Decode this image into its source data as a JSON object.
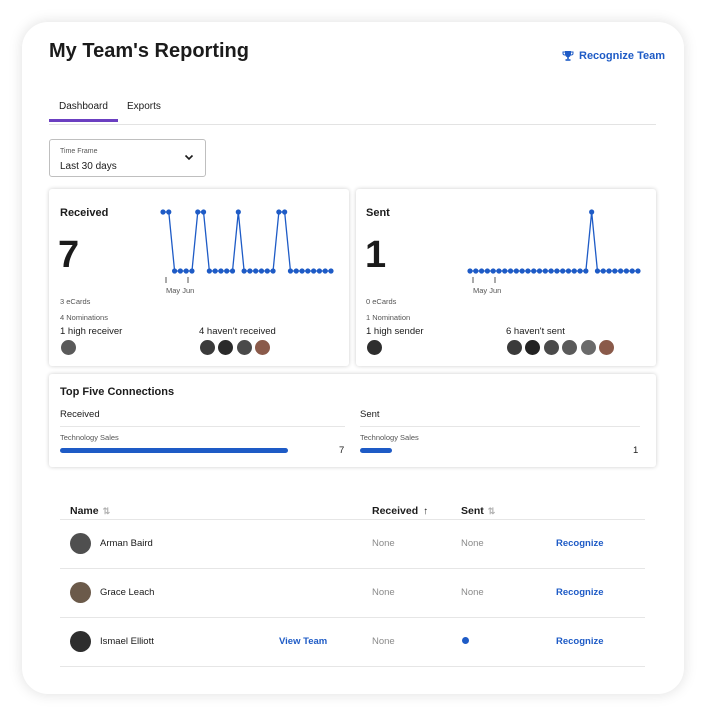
{
  "header": {
    "title": "My Team's Reporting",
    "recognize_team": "Recognize Team"
  },
  "tabs": [
    {
      "label": "Dashboard",
      "active": true
    },
    {
      "label": "Exports",
      "active": false
    }
  ],
  "time_frame": {
    "label": "Time Frame",
    "value": "Last 30 days"
  },
  "received_card": {
    "title": "Received",
    "total": "7",
    "ecards": "3 eCards",
    "nominations": "4 Nominations",
    "high_label": "1 high receiver",
    "havent_label": "4 haven't received",
    "axis_labels": [
      "May",
      "Jun"
    ],
    "high_avatar_count": 1,
    "havent_avatar_count": 4
  },
  "sent_card": {
    "title": "Sent",
    "total": "1",
    "ecards": "0 eCards",
    "nominations": "1 Nomination",
    "high_label": "1 high sender",
    "havent_label": "6 haven't sent",
    "axis_labels": [
      "May",
      "Jun"
    ],
    "high_avatar_count": 1,
    "havent_avatar_count": 6
  },
  "chart_data": [
    {
      "type": "line",
      "title": "Received",
      "x": [
        1,
        2,
        3,
        4,
        5,
        6,
        7,
        8,
        9,
        10,
        11,
        12,
        13,
        14,
        15,
        16,
        17,
        18,
        19,
        20,
        21,
        22,
        23,
        24,
        25,
        26,
        27,
        28,
        29,
        30
      ],
      "values": [
        1,
        1,
        0,
        0,
        0,
        0,
        1,
        1,
        0,
        0,
        0,
        0,
        0,
        1,
        0,
        0,
        0,
        0,
        0,
        0,
        1,
        1,
        0,
        0,
        0,
        0,
        0,
        0,
        0,
        0
      ],
      "xlabel": "",
      "ylabel": "",
      "tick_labels": [
        "May",
        "Jun"
      ],
      "color": "#1e5bc6"
    },
    {
      "type": "line",
      "title": "Sent",
      "x": [
        1,
        2,
        3,
        4,
        5,
        6,
        7,
        8,
        9,
        10,
        11,
        12,
        13,
        14,
        15,
        16,
        17,
        18,
        19,
        20,
        21,
        22,
        23,
        24,
        25,
        26,
        27,
        28,
        29,
        30
      ],
      "values": [
        0,
        0,
        0,
        0,
        0,
        0,
        0,
        0,
        0,
        0,
        0,
        0,
        0,
        0,
        0,
        0,
        0,
        0,
        0,
        0,
        0,
        1,
        0,
        0,
        0,
        0,
        0,
        0,
        0,
        0
      ],
      "xlabel": "",
      "ylabel": "",
      "tick_labels": [
        "May",
        "Jun"
      ],
      "color": "#1e5bc6"
    }
  ],
  "connections": {
    "title": "Top Five Connections",
    "received": {
      "label": "Received",
      "dept": "Technology Sales",
      "value": "7",
      "fraction": 1.0
    },
    "sent": {
      "label": "Sent",
      "dept": "Technology Sales",
      "value": "1",
      "fraction": 0.12
    }
  },
  "table": {
    "headers": {
      "name": "Name",
      "received": "Received",
      "sent": "Sent"
    },
    "rows": [
      {
        "name": "Arman Baird",
        "received": "None",
        "sent": "None",
        "action": "Recognize",
        "view_team": "",
        "sent_dot": false
      },
      {
        "name": "Grace Leach",
        "received": "None",
        "sent": "None",
        "action": "Recognize",
        "view_team": "",
        "sent_dot": false
      },
      {
        "name": "Ismael Elliott",
        "received": "None",
        "sent": "",
        "action": "Recognize",
        "view_team": "View Team",
        "sent_dot": true
      }
    ]
  },
  "colors": {
    "accent": "#1e5bc6",
    "tab_underline": "#6b3fc1"
  }
}
